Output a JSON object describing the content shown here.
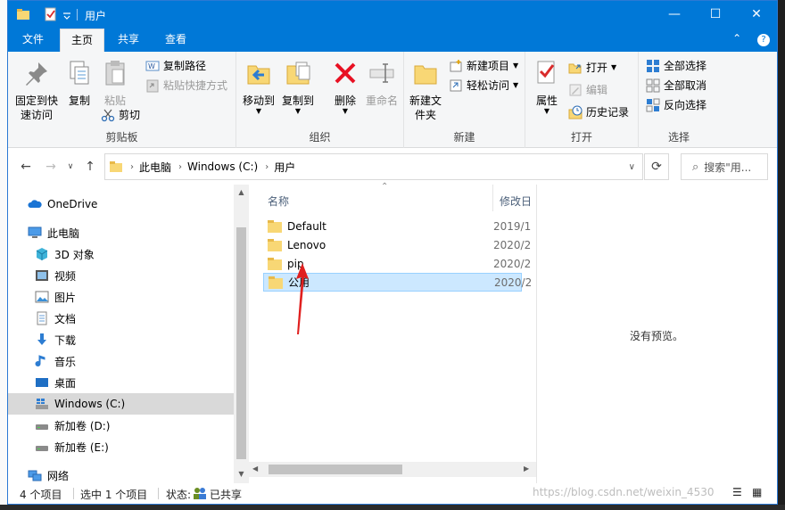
{
  "window": {
    "title": "用户",
    "controls": {
      "minimize": "—",
      "maximize": "☐",
      "close": "✕"
    }
  },
  "ribbon_tabs": [
    {
      "label": "文件"
    },
    {
      "label": "主页"
    },
    {
      "label": "共享"
    },
    {
      "label": "查看"
    }
  ],
  "ribbon": {
    "clipboard": {
      "pin_label": "固定到快速访问",
      "copy_label": "复制",
      "paste_label": "粘贴",
      "copy_path_label": "复制路径",
      "paste_shortcut_label": "粘贴快捷方式",
      "cut_label": "剪切",
      "group_label": "剪贴板"
    },
    "organize": {
      "move_label": "移动到",
      "copyto_label": "复制到",
      "delete_label": "删除",
      "rename_label": "重命名",
      "group_label": "组织"
    },
    "new": {
      "new_folder_label": "新建文件夹",
      "new_item_label": "新建项目",
      "easy_access_label": "轻松访问",
      "group_label": "新建"
    },
    "open": {
      "properties_label": "属性",
      "open_label": "打开",
      "edit_label": "编辑",
      "history_label": "历史记录",
      "group_label": "打开"
    },
    "select": {
      "select_all_label": "全部选择",
      "select_none_label": "全部取消",
      "invert_label": "反向选择",
      "group_label": "选择"
    }
  },
  "address": {
    "crumbs": [
      "此电脑",
      "Windows (C:)",
      "用户"
    ],
    "search_placeholder": "搜索\"用..."
  },
  "nav_pane": {
    "items": [
      {
        "label": "OneDrive"
      },
      {
        "label": "此电脑"
      },
      {
        "label": "3D 对象"
      },
      {
        "label": "视频"
      },
      {
        "label": "图片"
      },
      {
        "label": "文档"
      },
      {
        "label": "下载"
      },
      {
        "label": "音乐"
      },
      {
        "label": "桌面"
      },
      {
        "label": "Windows (C:)"
      },
      {
        "label": "新加卷 (D:)"
      },
      {
        "label": "新加卷 (E:)"
      },
      {
        "label": "网络"
      }
    ]
  },
  "file_list": {
    "columns": {
      "name": "名称",
      "modified": "修改日"
    },
    "rows": [
      {
        "name": "Default",
        "date": "2019/1"
      },
      {
        "name": "Lenovo",
        "date": "2020/2"
      },
      {
        "name": "pip",
        "date": "2020/2"
      },
      {
        "name": "公用",
        "date": "2020/2"
      }
    ]
  },
  "preview": {
    "text": "没有预览。"
  },
  "status": {
    "count": "4 个项目",
    "selected": "选中 1 个项目",
    "state_label": "状态:",
    "state_value": "已共享"
  },
  "watermark": "https://blog.csdn.net/weixin_4530",
  "colors": {
    "accent": "#0078d7",
    "selection": "#cce8ff",
    "annotation_arrow": "#e0201f"
  }
}
